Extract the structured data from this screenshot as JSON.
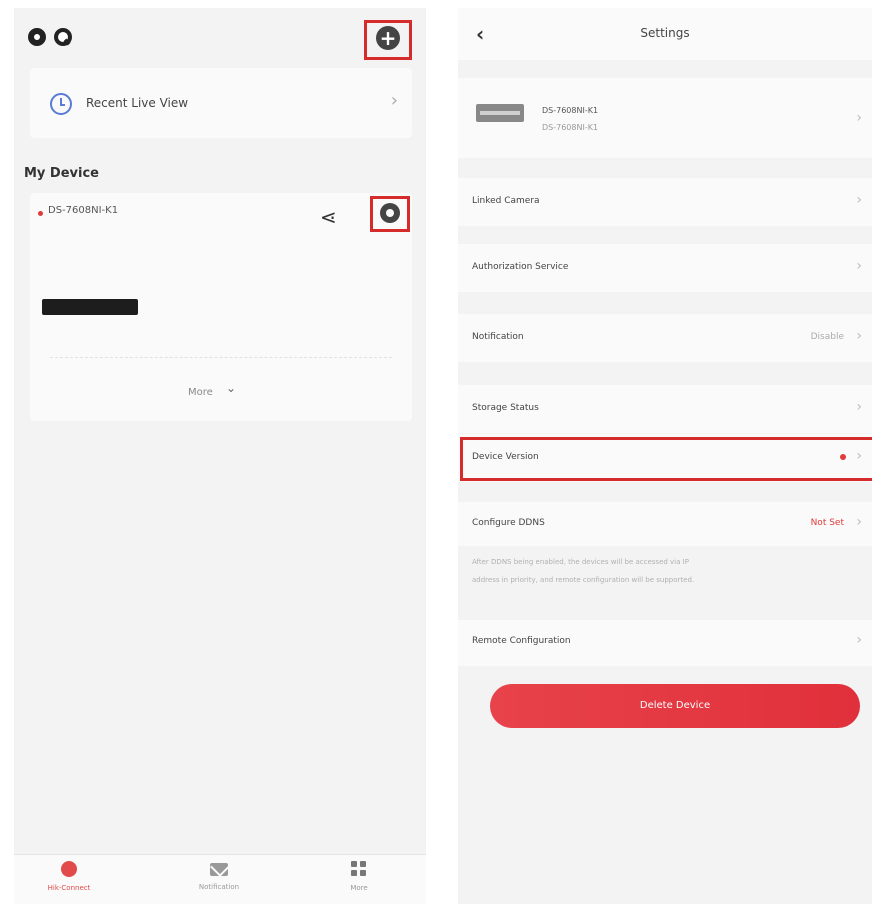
{
  "left": {
    "recent_live_view": "Recent Live View",
    "my_device_title": "My Device",
    "device": {
      "name": "DS-7608NI-K1",
      "more_label": "More"
    },
    "bottom_nav": [
      {
        "label": "Hik-Connect",
        "icon": "home-icon",
        "active": true
      },
      {
        "label": "Notification",
        "icon": "mail-icon",
        "active": false
      },
      {
        "label": "More",
        "icon": "grid-icon",
        "active": false
      }
    ]
  },
  "right": {
    "title": "Settings",
    "device_name": "DS-7608NI-K1",
    "device_model": "DS-7608NI-K1",
    "rows": {
      "linked_camera": "Linked Camera",
      "authorization_service": "Authorization Service",
      "notification": "Notification",
      "notification_value": "Disable",
      "storage_status": "Storage Status",
      "device_version": "Device Version",
      "configure_ddns": "Configure DDNS",
      "configure_ddns_value": "Not Set",
      "remote_configuration": "Remote Configuration"
    },
    "ddns_note_line1": "After DDNS being enabled, the devices will be accessed via IP",
    "ddns_note_line2": "address in priority, and remote configuration will be supported.",
    "delete_button": "Delete Device"
  },
  "colors": {
    "highlight": "#d62b2b",
    "accent_red": "#e03a3a",
    "clock_blue": "#5a7bd6"
  }
}
